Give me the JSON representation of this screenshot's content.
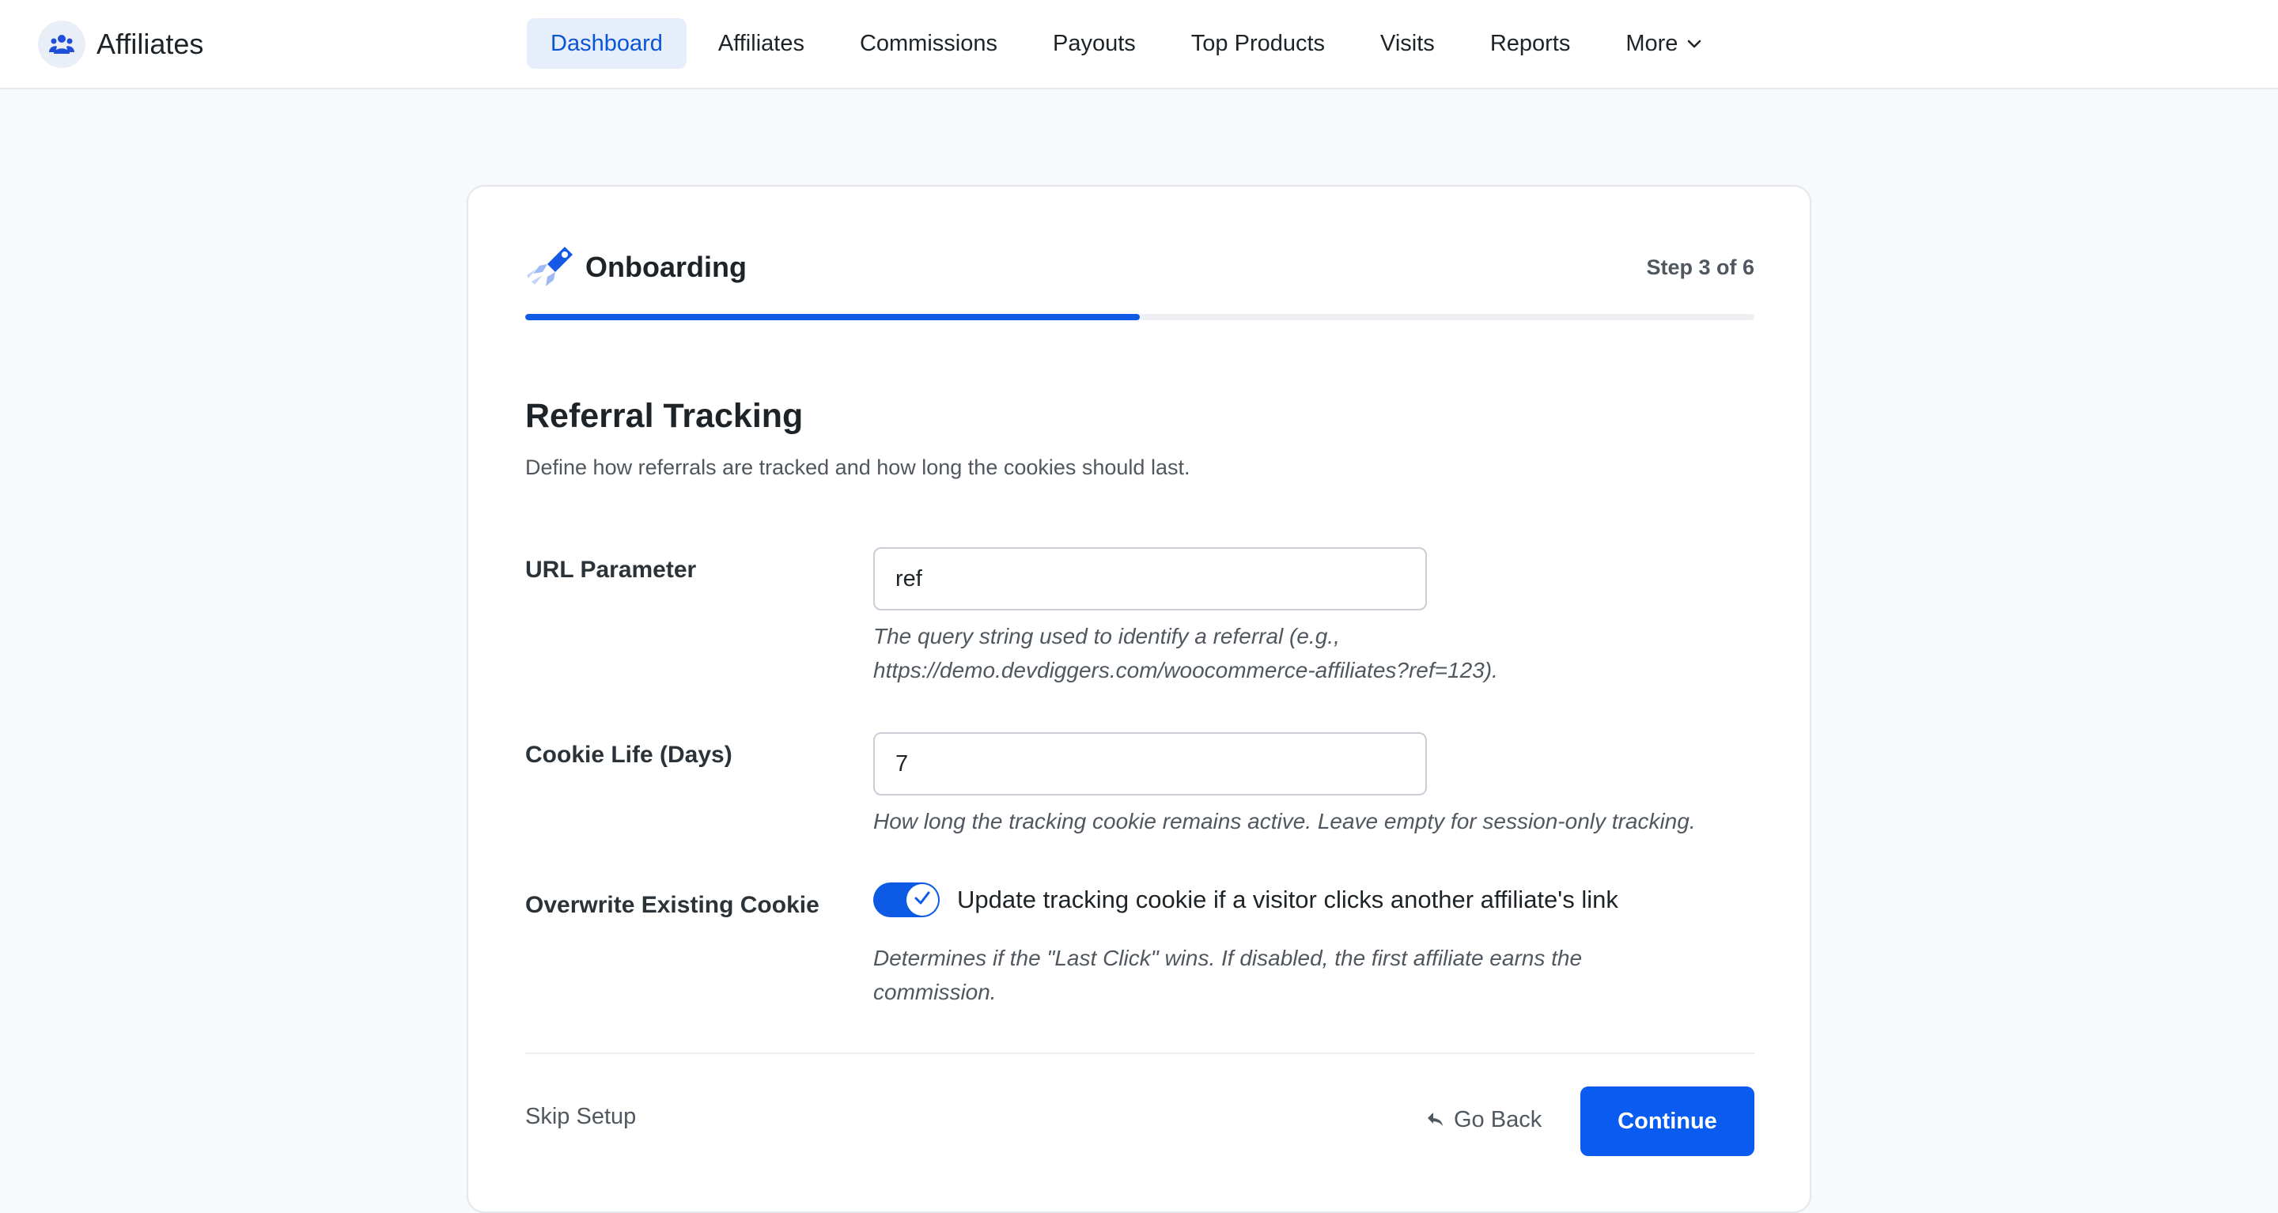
{
  "app": {
    "name": "Affiliates",
    "logo_icon": "users-icon"
  },
  "nav": {
    "items": [
      {
        "label": "Dashboard",
        "active": true
      },
      {
        "label": "Affiliates"
      },
      {
        "label": "Commissions"
      },
      {
        "label": "Payouts"
      },
      {
        "label": "Top Products"
      },
      {
        "label": "Visits"
      },
      {
        "label": "Reports"
      },
      {
        "label": "More",
        "icon": "chevron-down-icon"
      }
    ]
  },
  "onboarding": {
    "title": "Onboarding",
    "title_icon": "rocket-icon",
    "step_text": "Step 3 of 6",
    "progress_fraction": 0.5
  },
  "section": {
    "title": "Referral Tracking",
    "subtitle": "Define how referrals are tracked and how long the cookies should last."
  },
  "fields": {
    "url_parameter": {
      "label": "URL Parameter",
      "value": "ref",
      "help_line1": "The query string used to identify a referral (e.g.,",
      "help_line2": "https://demo.devdiggers.com/woocommerce-affiliates?ref=123)."
    },
    "cookie_life": {
      "label": "Cookie Life (Days)",
      "value": "7",
      "help": "How long the tracking cookie remains active. Leave empty for session-only tracking."
    },
    "overwrite_cookie": {
      "label": "Overwrite Existing Cookie",
      "enabled": true,
      "toggle_label": "Update tracking cookie if a visitor clicks another affiliate's link",
      "help_line1": "Determines if the \"Last Click\" wins. If disabled, the first affiliate earns the",
      "help_line2": "commission."
    }
  },
  "footer": {
    "skip_label": "Skip Setup",
    "back_label": "Go Back",
    "back_icon": "back-arrow-icon",
    "continue_label": "Continue"
  },
  "colors": {
    "accent": "#0a5bf0",
    "nav_active_bg": "#e6eefb",
    "nav_active_text": "#0a55d6"
  }
}
